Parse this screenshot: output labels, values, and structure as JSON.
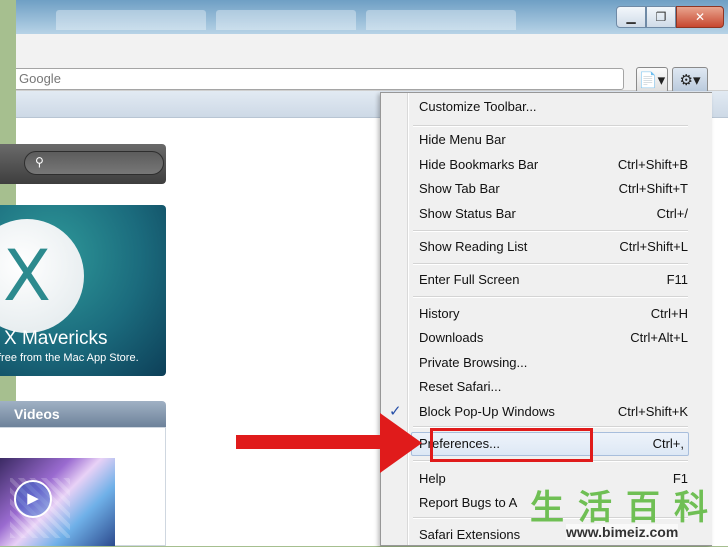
{
  "window": {
    "minimize_label": "▁",
    "maximize_label": "❐",
    "close_label": "✕"
  },
  "toolbar": {
    "search_placeholder": "Google",
    "page_icon": "📄▾",
    "gear_icon": "⚙▾"
  },
  "promo": {
    "title": "X Mavericks",
    "subtitle": "free from the Mac App Store.",
    "logo_letter": "X"
  },
  "videos": {
    "heading": "Videos"
  },
  "menu": {
    "items": [
      {
        "label": "Customize Toolbar...",
        "shortcut": ""
      },
      {
        "label": "Hide Menu Bar",
        "shortcut": ""
      },
      {
        "label": "Hide Bookmarks Bar",
        "shortcut": "Ctrl+Shift+B"
      },
      {
        "label": "Show Tab Bar",
        "shortcut": "Ctrl+Shift+T"
      },
      {
        "label": "Show Status Bar",
        "shortcut": "Ctrl+/"
      },
      {
        "label": "Show Reading List",
        "shortcut": "Ctrl+Shift+L"
      },
      {
        "label": "Enter Full Screen",
        "shortcut": "F11"
      },
      {
        "label": "History",
        "shortcut": "Ctrl+H"
      },
      {
        "label": "Downloads",
        "shortcut": "Ctrl+Alt+L"
      },
      {
        "label": "Private Browsing...",
        "shortcut": ""
      },
      {
        "label": "Reset Safari...",
        "shortcut": ""
      },
      {
        "label": "Block Pop-Up Windows",
        "shortcut": "Ctrl+Shift+K",
        "checked": true
      },
      {
        "label": "Preferences...",
        "shortcut": "Ctrl+,"
      },
      {
        "label": "Help",
        "shortcut": "F1"
      },
      {
        "label": "Report Bugs to A",
        "shortcut": ""
      },
      {
        "label": "Safari Extensions",
        "shortcut": ""
      }
    ],
    "check_mark": "✓"
  },
  "watermark": {
    "chinese": "生活百科",
    "url": "www.bimeiz.com"
  },
  "colors": {
    "highlight_red": "#e01b1b",
    "titlebar_blue": "#6f9fc4"
  }
}
